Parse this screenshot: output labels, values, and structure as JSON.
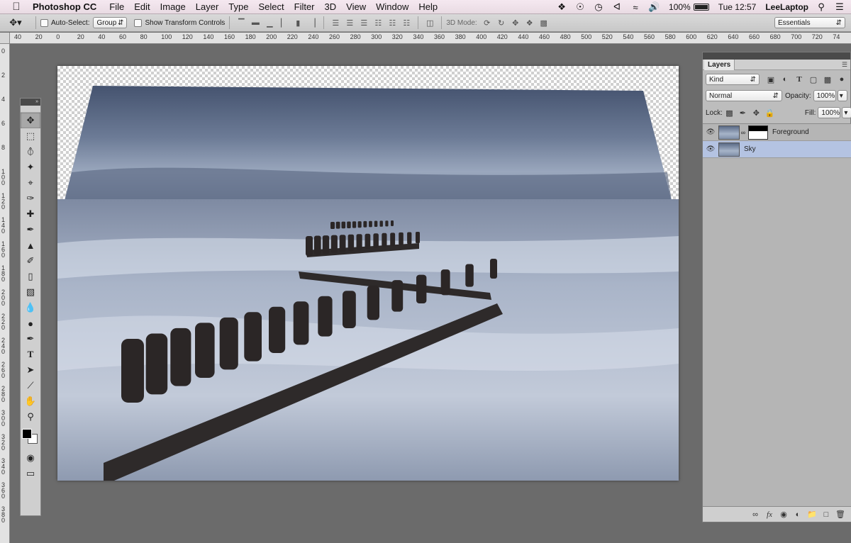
{
  "menubar": {
    "app_name": "Photoshop CC",
    "items": [
      "File",
      "Edit",
      "Image",
      "Layer",
      "Type",
      "Select",
      "Filter",
      "3D",
      "View",
      "Window",
      "Help"
    ],
    "battery": "100%",
    "clock": "Tue 12:57",
    "user": "LeeLaptop"
  },
  "options": {
    "auto_select_label": "Auto-Select:",
    "auto_select_value": "Group",
    "show_transform_label": "Show Transform Controls",
    "mode_label": "3D Mode:",
    "workspace": "Essentials"
  },
  "ruler": {
    "h_ticks": [
      "40",
      "20",
      "0",
      "20",
      "40",
      "60",
      "80",
      "100",
      "120",
      "140",
      "160",
      "180",
      "200",
      "220",
      "240",
      "260",
      "280",
      "300",
      "320",
      "340",
      "360",
      "380",
      "400",
      "420",
      "440",
      "460",
      "480",
      "500",
      "520",
      "540",
      "560",
      "580",
      "600",
      "620",
      "640",
      "660",
      "680",
      "700",
      "720",
      "74"
    ],
    "v_ticks": [
      "0",
      "2",
      "4",
      "6",
      "8",
      "100",
      "120",
      "140",
      "160",
      "180",
      "200",
      "220",
      "240",
      "260",
      "280",
      "300",
      "320",
      "340",
      "360",
      "380"
    ]
  },
  "layers_panel": {
    "tab": "Layers",
    "filter": "Kind",
    "blend_mode": "Normal",
    "opacity_label": "Opacity:",
    "opacity_value": "100%",
    "lock_label": "Lock:",
    "fill_label": "Fill:",
    "fill_value": "100%",
    "layers": [
      {
        "name": "Foreground",
        "selected": false
      },
      {
        "name": "Sky",
        "selected": true
      }
    ]
  },
  "colors": {
    "selected_layer": "#b4c3e2",
    "workspace_bg": "#6b6b6b"
  }
}
